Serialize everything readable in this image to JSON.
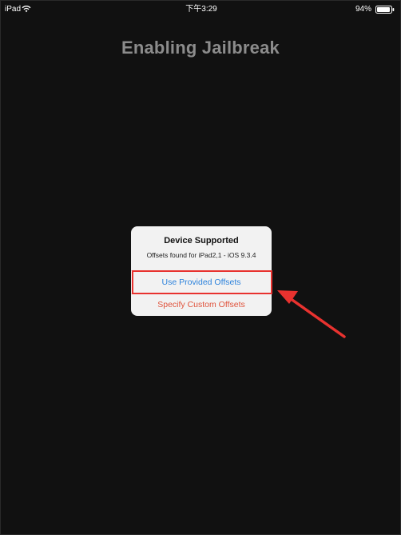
{
  "status_bar": {
    "device": "iPad",
    "time": "下午3:29",
    "battery": "94%",
    "battery_level": 0.94
  },
  "page": {
    "title": "Enabling Jailbreak"
  },
  "alert": {
    "title": "Device Supported",
    "message": "Offsets found for iPad2,1 - iOS 9.3.4",
    "buttons": {
      "provided": "Use Provided Offsets",
      "custom": "Specify Custom Offsets"
    }
  },
  "colors": {
    "background": "#111111",
    "title": "#8c8c8c",
    "button_blue": "#2d83dc",
    "button_red": "#e0533c",
    "annotation_red": "#e8322f"
  },
  "icons": [
    "wifi-icon",
    "battery-icon",
    "annotation-arrow-icon"
  ]
}
